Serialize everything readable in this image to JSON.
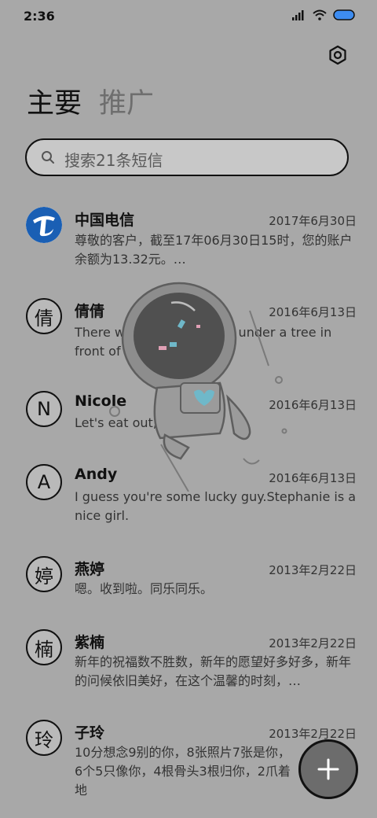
{
  "status": {
    "time": "2:36"
  },
  "tabs": [
    {
      "label": "主要"
    },
    {
      "label": "推广"
    }
  ],
  "search": {
    "placeholder": "搜索21条短信"
  },
  "messages": [
    {
      "name": "中国电信",
      "date": "2017年6月30日",
      "preview": "尊敬的客户，截至17年06月30日15时，您的账户余额为13.32元。…",
      "avatar": "china-telecom-logo"
    },
    {
      "name": "倩倩",
      "date": "2016年6月13日",
      "preview": "There was a table set out under a tree in front of the hous",
      "avatar": "倩"
    },
    {
      "name": "Nicole",
      "date": "2016年6月13日",
      "preview": "Let's eat out,shall we?",
      "avatar": "N"
    },
    {
      "name": "Andy",
      "date": "2016年6月13日",
      "preview": "I guess you're some lucky guy.Stephanie is a nice girl.",
      "avatar": "A"
    },
    {
      "name": "燕婷",
      "date": "2013年2月22日",
      "preview": "嗯。收到啦。同乐同乐。",
      "avatar": "婷"
    },
    {
      "name": "紫楠",
      "date": "2013年2月22日",
      "preview": "新年的祝福数不胜数，新年的愿望好多好多，新年的问候依旧美好，在这个温馨的时刻，…",
      "avatar": "楠"
    },
    {
      "name": "子玲",
      "date": "2013年2月22日",
      "preview": "10分想念9别的你，8张照片7张是你，6个5只像你，4根骨头3根归你，2爪着地",
      "avatar": "玲"
    }
  ],
  "colors": {
    "background": "#a8a8a8",
    "telecom_blue": "#1a5fb4",
    "fab": "#6c6c6c"
  },
  "icons": [
    "signal-icon",
    "wifi-icon",
    "battery-icon",
    "settings-icon",
    "search-icon",
    "add-icon"
  ]
}
